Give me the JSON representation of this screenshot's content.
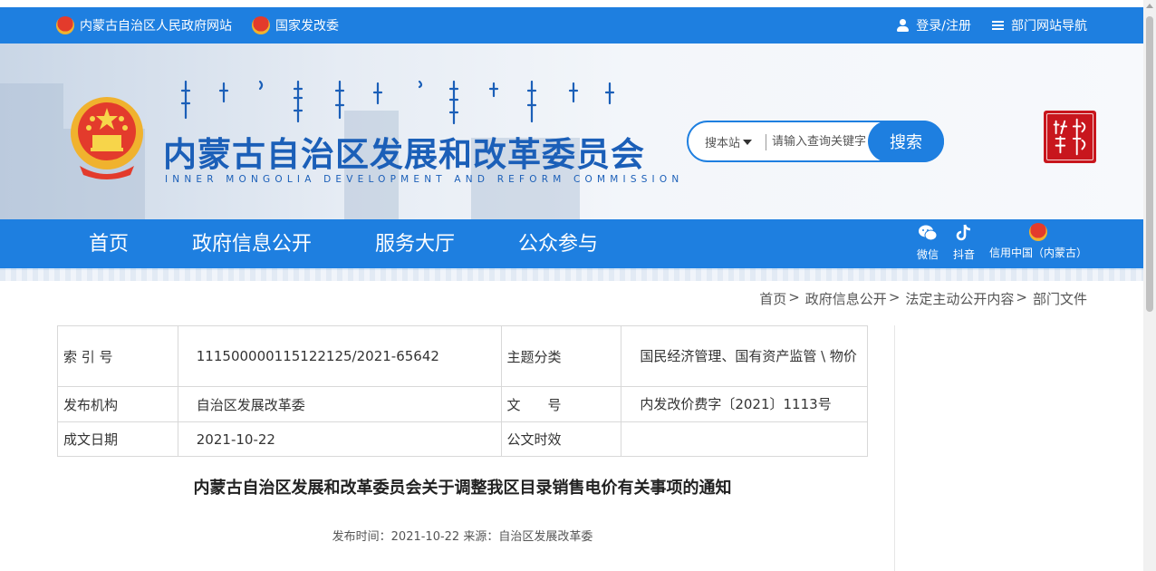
{
  "topbar": {
    "left_links": [
      "内蒙古自治区人民政府网站",
      "国家发改委"
    ],
    "login": "登录/注册",
    "sitemap": "部门网站导航"
  },
  "banner": {
    "title": "内蒙古自治区发展和改革委员会",
    "subtitle": "INNER MONGOLIA DEVELOPMENT AND REFORM COMMISSION"
  },
  "search": {
    "scope": "搜本站",
    "placeholder": "请输入查询关键字",
    "button": "搜索"
  },
  "nav": {
    "items": [
      "首页",
      "政府信息公开",
      "服务大厅",
      "公众参与"
    ],
    "social": [
      "微信",
      "抖音",
      "信用中国（内蒙古）"
    ]
  },
  "breadcrumb": [
    "首页",
    "政府信息公开",
    "法定主动公开内容",
    "部门文件"
  ],
  "info": {
    "index_label": "索 引 号",
    "index_value": "11150000011512212​5/2021-65642",
    "topic_label": "主题分类",
    "topic_value": "国民经济管理、国有资产监管 \\ 物价",
    "publisher_label": "发布机构",
    "publisher_value": "自治区发展改革委",
    "docno_label": "文　　号",
    "docno_value": "内发改价费字〔2021〕1113号",
    "date_label": "成文日期",
    "date_value": "2021-10-22",
    "validity_label": "公文时效",
    "validity_value": ""
  },
  "document": {
    "title": "内蒙古自治区发展和改革委员会关于调整我区目录销售电价有关事项的通知",
    "meta": "发布时间：2021-10-22   来源：自治区发展改革委"
  },
  "colors": {
    "primary": "#1e7fe0",
    "title_blue": "#1b5fb8",
    "seal_red": "#c8161d"
  }
}
